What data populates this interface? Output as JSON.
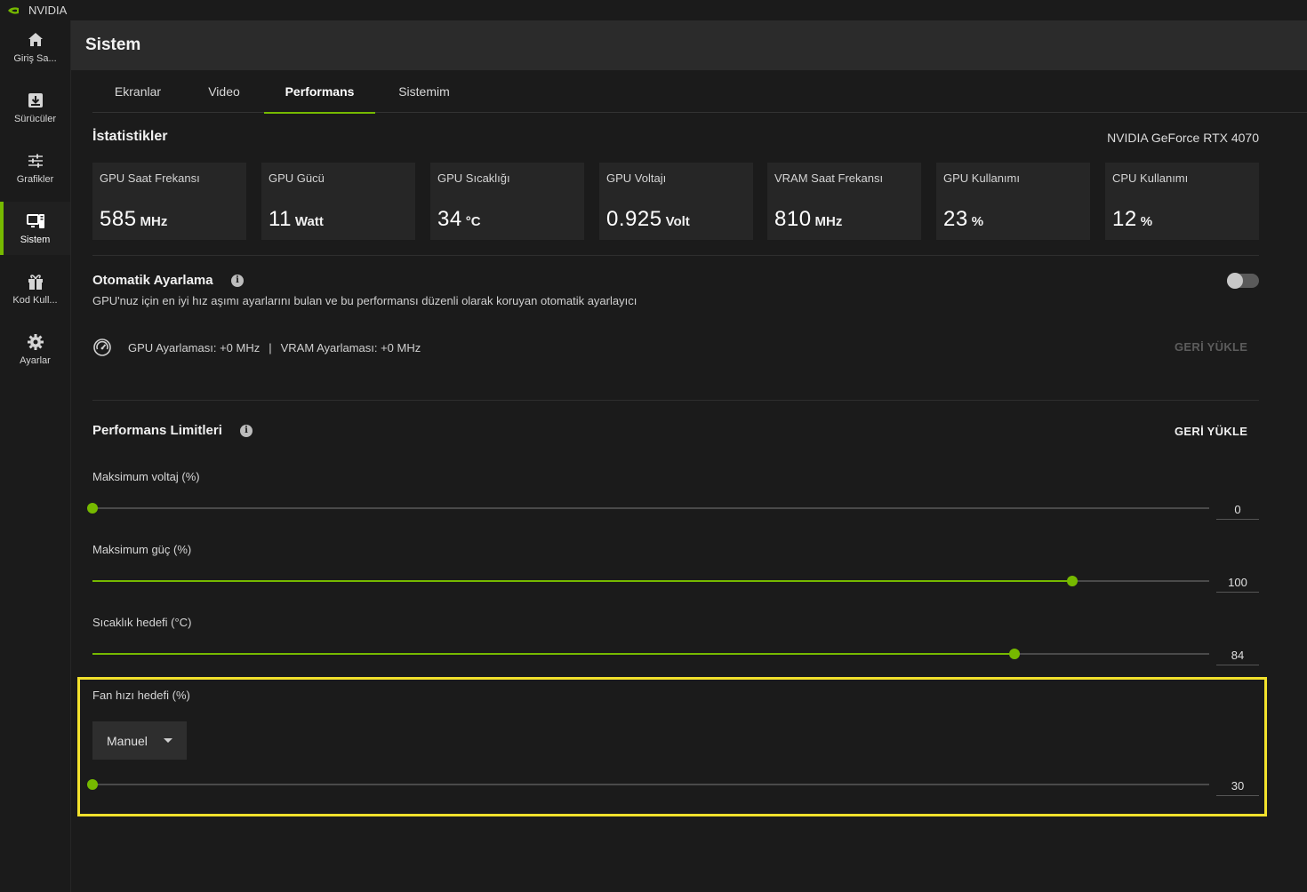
{
  "app": {
    "name": "NVIDIA"
  },
  "colors": {
    "accent": "#76b900",
    "highlight": "#f2e12c"
  },
  "sidebar": {
    "items": [
      {
        "label": "Giriş Sa...",
        "icon": "home-icon"
      },
      {
        "label": "Sürücüler",
        "icon": "download-icon"
      },
      {
        "label": "Grafikler",
        "icon": "sliders-icon"
      },
      {
        "label": "Sistem",
        "icon": "system-icon",
        "active": true
      },
      {
        "label": "Kod Kull...",
        "icon": "gift-icon"
      },
      {
        "label": "Ayarlar",
        "icon": "gear-icon"
      }
    ]
  },
  "header": {
    "title": "Sistem"
  },
  "tabs": [
    {
      "label": "Ekranlar"
    },
    {
      "label": "Video"
    },
    {
      "label": "Performans",
      "active": true
    },
    {
      "label": "Sistemim"
    }
  ],
  "stats": {
    "title": "İstatistikler",
    "gpu_name": "NVIDIA GeForce RTX 4070",
    "cards": [
      {
        "label": "GPU Saat Frekansı",
        "value": "585",
        "unit": "MHz"
      },
      {
        "label": "GPU Gücü",
        "value": "11",
        "unit": "Watt"
      },
      {
        "label": "GPU Sıcaklığı",
        "value": "34",
        "unit": "°C"
      },
      {
        "label": "GPU Voltajı",
        "value": "0.925",
        "unit": "Volt"
      },
      {
        "label": "VRAM Saat Frekansı",
        "value": "810",
        "unit": "MHz"
      },
      {
        "label": "GPU Kullanımı",
        "value": "23",
        "unit": "%"
      },
      {
        "label": "CPU Kullanımı",
        "value": "12",
        "unit": "%"
      }
    ]
  },
  "auto_tune": {
    "title": "Otomatik Ayarlama",
    "description": "GPU'nuz için en iyi hız aşımı ayarlarını bulan ve bu performansı düzenli olarak koruyan otomatik ayarlayıcı",
    "enabled": false,
    "gpu_offset": "GPU Ayarlaması: +0 MHz",
    "separator": "|",
    "vram_offset": "VRAM Ayarlaması: +0 MHz",
    "reset_label": "GERİ YÜKLE"
  },
  "limits": {
    "title": "Performans Limitleri",
    "reset_label": "GERİ YÜKLE",
    "sliders": [
      {
        "label": "Maksimum voltaj (%)",
        "value": "0",
        "fraction": 0.0
      },
      {
        "label": "Maksimum güç (%)",
        "value": "100",
        "fraction": 0.877
      },
      {
        "label": "Sıcaklık hedefi (°C)",
        "value": "84",
        "fraction": 0.826
      }
    ],
    "fan": {
      "label": "Fan hızı hedefi (%)",
      "mode": "Manuel",
      "value": "30",
      "fraction": 0.0
    }
  }
}
